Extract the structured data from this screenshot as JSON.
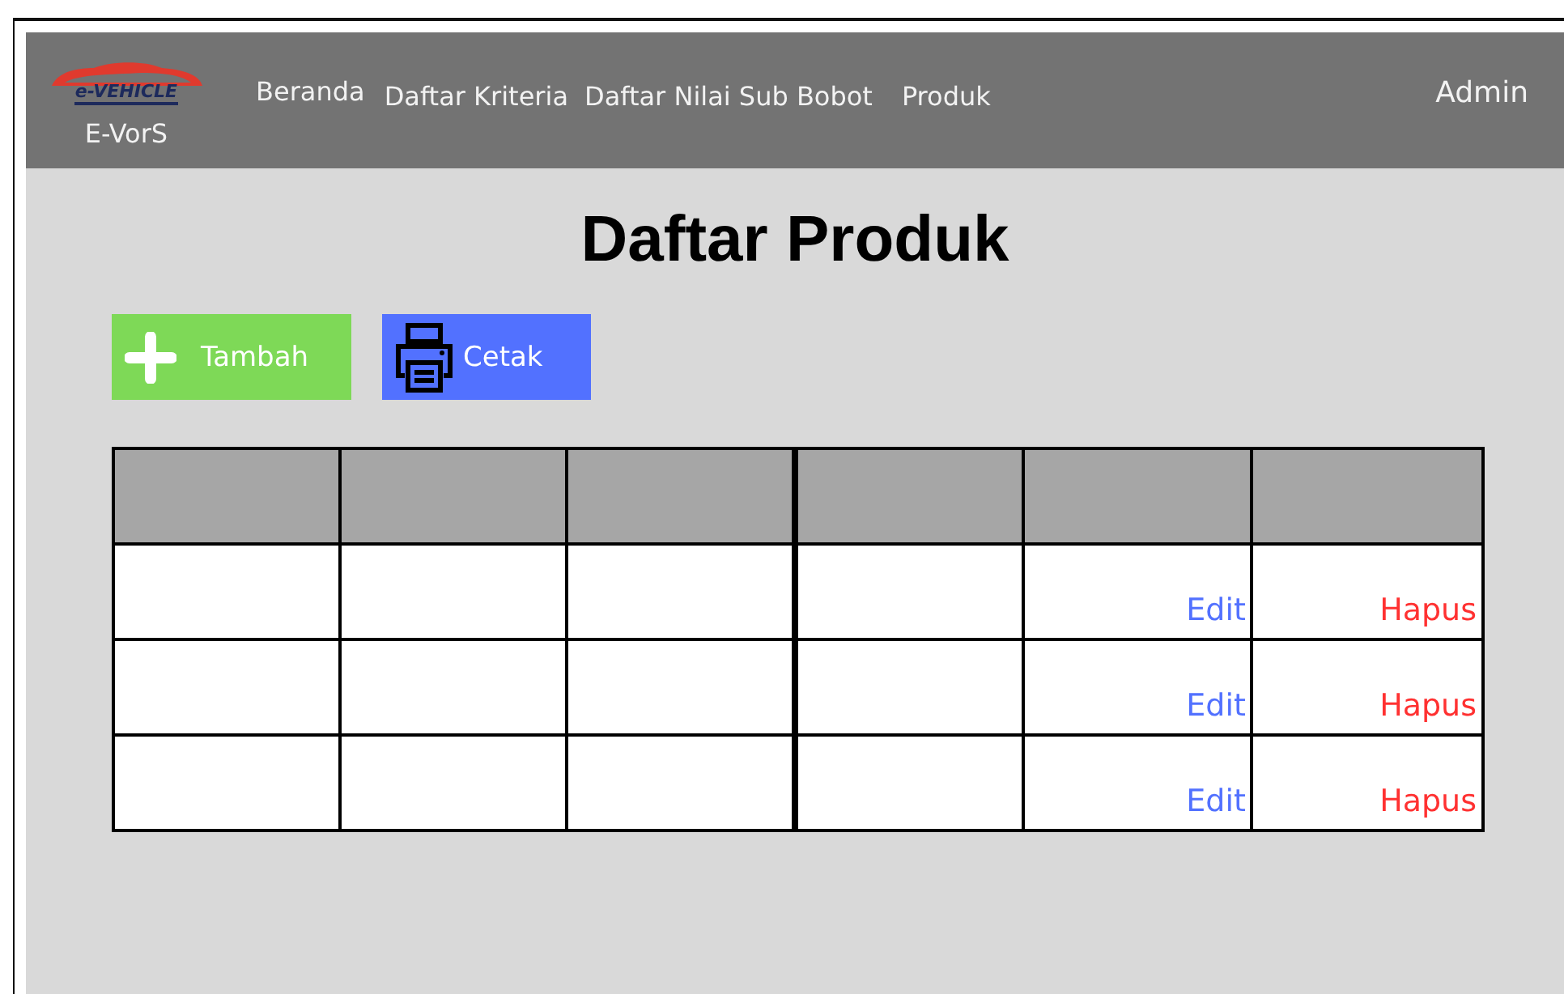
{
  "navbar": {
    "logo_text": "e-VEHICLE",
    "brand": "E-VorS",
    "links": [
      {
        "label": "Beranda"
      },
      {
        "label": "Daftar Kriteria"
      },
      {
        "label": "Daftar Nilai Sub Bobot"
      },
      {
        "label": "Produk"
      }
    ],
    "user": "Admin"
  },
  "title": "Daftar Produk",
  "actions": [
    {
      "kind": "add",
      "label": "Tambah"
    },
    {
      "kind": "print",
      "label": "Cetak"
    }
  ],
  "table": {
    "rows": [
      {
        "edit": "Edit",
        "delete": "Hapus"
      },
      {
        "edit": "Edit",
        "delete": "Hapus"
      },
      {
        "edit": "Edit",
        "delete": "Hapus"
      }
    ]
  }
}
